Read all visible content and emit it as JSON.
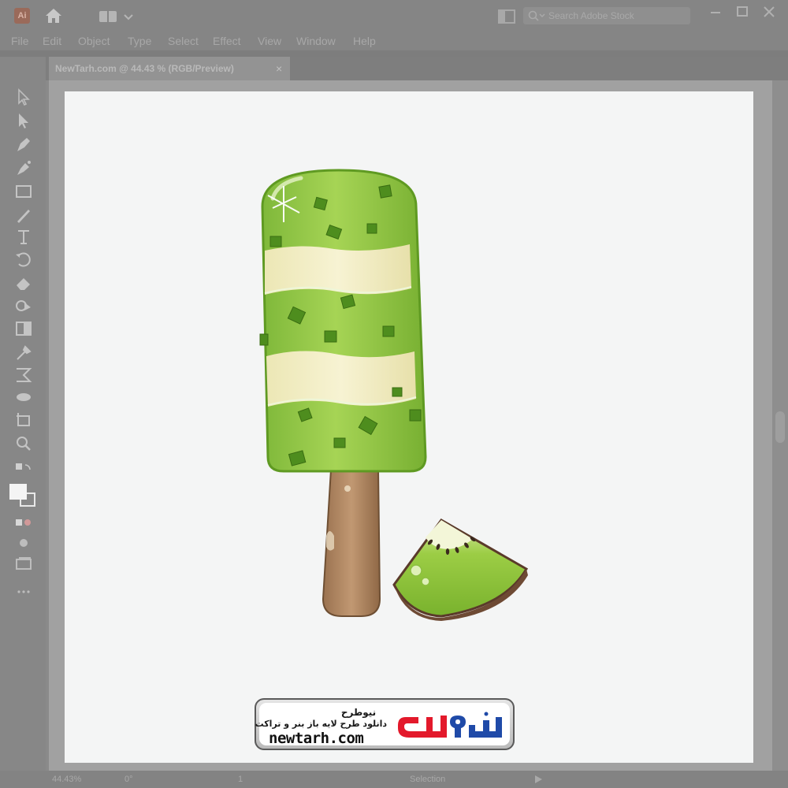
{
  "app": {
    "logo_text": "Ai",
    "search_placeholder": "Search Adobe Stock"
  },
  "menu": [
    "File",
    "Edit",
    "Object",
    "Type",
    "Select",
    "Effect",
    "View",
    "Window",
    "Help"
  ],
  "document_tab": {
    "label": "NewTarh.com @ 44.43 % (RGB/Preview)",
    "close": "×"
  },
  "tools": [
    "selection-tool",
    "direct-selection-tool",
    "pen-tool",
    "curvature-tool",
    "rectangle-tool",
    "paintbrush-tool",
    "type-tool",
    "rotate-tool",
    "eraser-tool",
    "shape-builder-tool",
    "gradient-tool",
    "eyedropper-tool",
    "blend-tool",
    "symbol-sprayer-tool",
    "artboard-tool",
    "zoom-tool"
  ],
  "status": {
    "zoom": "44.43%",
    "rotation": "0°",
    "artboard": "1",
    "mode": "Selection"
  },
  "brand": {
    "title_fa": "نیوطرح",
    "subtitle_fa": "دانلود طرح لایه باز بنر و تراکت",
    "url": "newtarh.com",
    "logo_fa": "نیوطرح"
  },
  "colors": {
    "popsicle_green": "#8cc63f",
    "cream": "#f3eec2",
    "stick": "#b58b62",
    "brand_red": "#e3192b",
    "brand_blue": "#1f4aa8"
  }
}
